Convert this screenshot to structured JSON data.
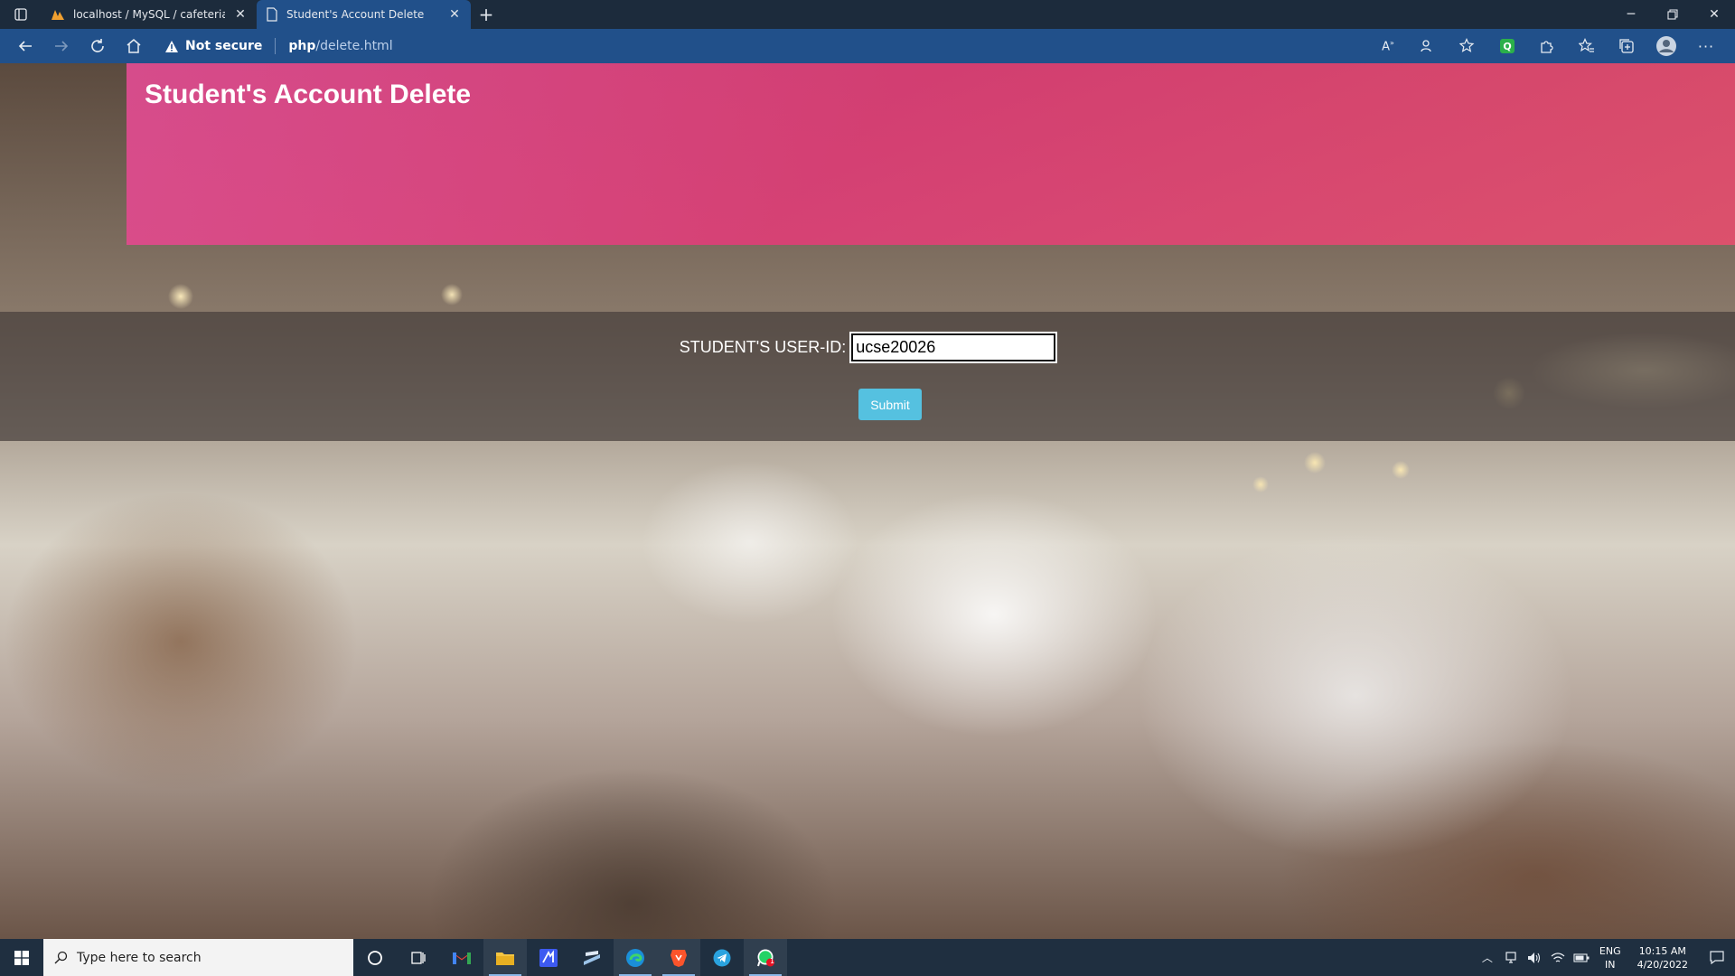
{
  "browser": {
    "tabs": [
      {
        "title": "localhost / MySQL / cafeteria / r",
        "active": false,
        "icon": "phpmyadmin-icon"
      },
      {
        "title": "Student's Account Delete",
        "active": true,
        "icon": "page-icon"
      }
    ],
    "address": {
      "security_label": "Not secure",
      "url_host": "php",
      "url_path": "/delete.html"
    }
  },
  "page": {
    "title": "Student's Account Delete",
    "form": {
      "label": "STUDENT'S USER-ID:",
      "input_value": "ucse20026",
      "submit_label": "Submit"
    }
  },
  "taskbar": {
    "search_placeholder": "Type here to search",
    "apps": [
      "cortana-icon",
      "task-view-icon",
      "gmail-icon",
      "file-explorer-icon",
      "visual-studio-icon",
      "paint-icon",
      "edge-icon",
      "brave-icon",
      "telegram-icon",
      "whatsapp-icon"
    ],
    "tray": {
      "language": "ENG",
      "region": "IN",
      "time": "10:15 AM",
      "date": "4/20/2022"
    },
    "whatsapp_badge": "1"
  },
  "colors": {
    "tabbar": "#1c2b3c",
    "toolbar": "#21508a",
    "banner": "#e24c8f",
    "submit": "#55c1e0",
    "taskbar": "#1f2f40"
  }
}
